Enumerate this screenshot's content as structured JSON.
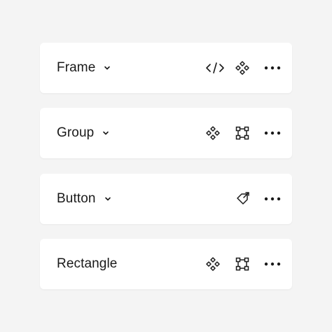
{
  "cards": [
    {
      "title": "Frame",
      "has_caret": true,
      "actions": [
        "code-icon",
        "component-icon",
        "more-icon"
      ]
    },
    {
      "title": "Group",
      "has_caret": true,
      "actions": [
        "component-icon",
        "frame-selection-icon",
        "more-icon"
      ]
    },
    {
      "title": "Button",
      "has_caret": true,
      "actions": [
        "detach-instance-icon",
        "more-icon"
      ]
    },
    {
      "title": "Rectangle",
      "has_caret": false,
      "actions": [
        "component-icon",
        "frame-selection-icon",
        "more-icon"
      ]
    }
  ],
  "colors": {
    "background": "#f4f4f4",
    "card": "#ffffff",
    "text": "#1a1a1a",
    "icon": "#1a1a1a"
  }
}
